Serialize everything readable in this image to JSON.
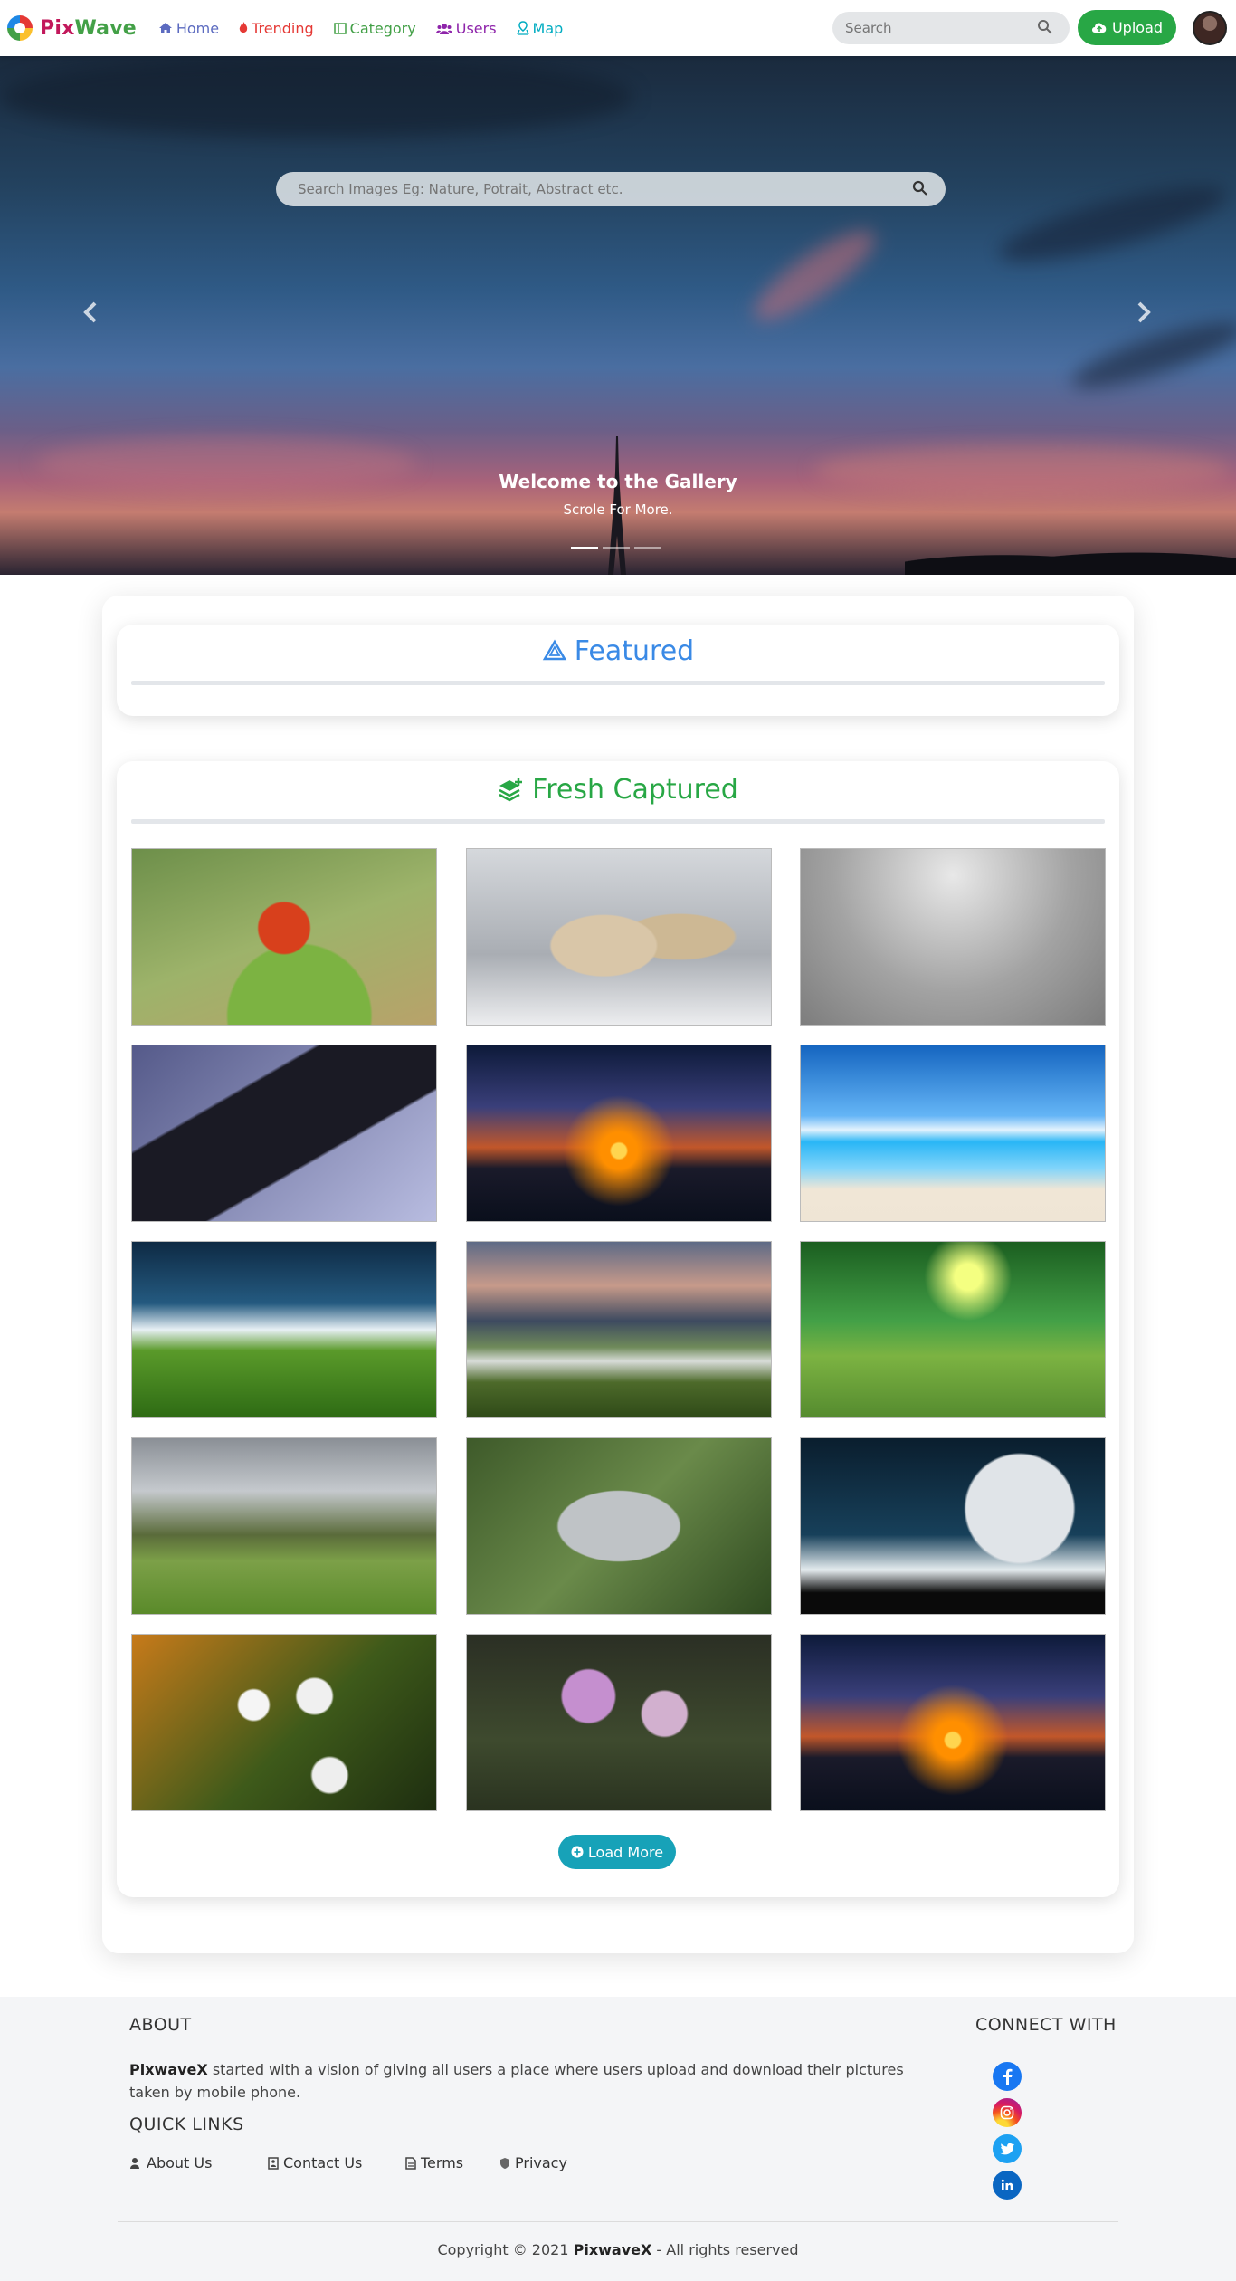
{
  "navbar": {
    "brand_part1": "Pix",
    "brand_part2": "Wave",
    "links": [
      {
        "label": "Home",
        "icon": "home-icon"
      },
      {
        "label": "Trending",
        "icon": "fire-icon"
      },
      {
        "label": "Category",
        "icon": "category-icon"
      },
      {
        "label": "Users",
        "icon": "users-icon"
      },
      {
        "label": "Map",
        "icon": "map-icon"
      }
    ],
    "search_placeholder": "Search",
    "upload_label": "Upload"
  },
  "hero": {
    "search_placeholder": "Search Images Eg: Nature, Potrait, Abstract etc.",
    "caption_title": "Welcome to the Gallery",
    "caption_subtitle": "Scrole For More.",
    "indicators": 3,
    "active_indicator": 1
  },
  "featured": {
    "title": "Featured"
  },
  "fresh": {
    "title": "Fresh Captured",
    "images": [
      {
        "subject": "red bird on leaf"
      },
      {
        "subject": "white wolves in snow"
      },
      {
        "subject": "gray linux wallpaper"
      },
      {
        "subject": "linux chip"
      },
      {
        "subject": "sunset over sea"
      },
      {
        "subject": "blue sea and beach"
      },
      {
        "subject": "green field under night sky"
      },
      {
        "subject": "river valley"
      },
      {
        "subject": "green forest"
      },
      {
        "subject": "meadow with fallen tree"
      },
      {
        "subject": "aerial garden"
      },
      {
        "subject": "full moon and tree"
      },
      {
        "subject": "white flowers"
      },
      {
        "subject": "pink flowers"
      },
      {
        "subject": "sunset over sea"
      }
    ],
    "load_more_label": "Load More"
  },
  "footer": {
    "about_heading": "ABOUT",
    "about_brand": "PixwaveX",
    "about_text": " started with a vision of giving all users a place where users upload and download their pictures taken by mobile phone.",
    "quick_links_heading": "QUICK LINKS",
    "quick_links": [
      {
        "label": "About Us"
      },
      {
        "label": "Contact Us"
      },
      {
        "label": "Terms"
      },
      {
        "label": "Privacy"
      }
    ],
    "connect_heading": "CONNECT WITH",
    "social": [
      "facebook-icon",
      "instagram-icon",
      "twitter-icon",
      "linkedin-icon"
    ],
    "copyright_prefix": "Copyright © 2021 ",
    "copyright_brand": "PixwaveX",
    "copyright_suffix": " - All rights reserved"
  },
  "colors": {
    "primary_blue": "#3a8ae6",
    "green": "#28a745",
    "teal": "#17a2b8"
  }
}
